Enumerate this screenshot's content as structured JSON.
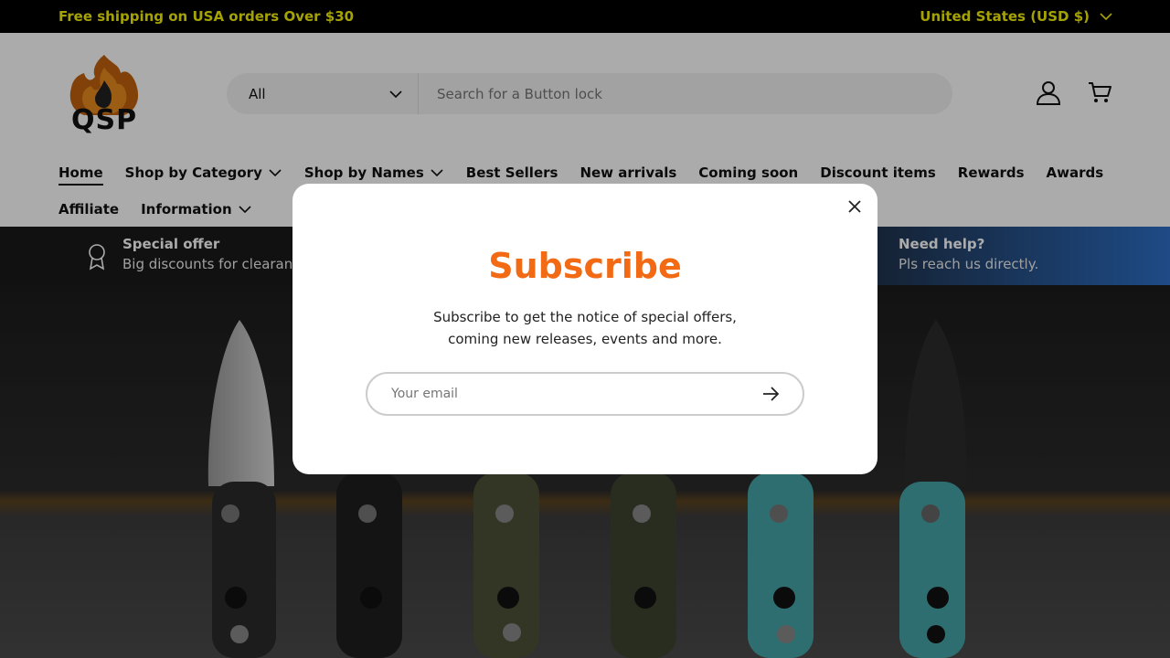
{
  "announcement": {
    "message": "Free shipping on USA orders Over $30",
    "country": "United States (USD $)"
  },
  "logo": {
    "text": "QSP"
  },
  "search": {
    "category": "All",
    "placeholder": "Search for a Button lock"
  },
  "header_icons": [
    "account-icon",
    "cart-icon"
  ],
  "nav": {
    "row1": [
      {
        "label": "Home",
        "active": true,
        "dropdown": false
      },
      {
        "label": "Shop by Category",
        "dropdown": true
      },
      {
        "label": "Shop by Names",
        "dropdown": true
      },
      {
        "label": "Best Sellers",
        "dropdown": false
      },
      {
        "label": "New arrivals",
        "dropdown": false
      },
      {
        "label": "Coming soon",
        "dropdown": false
      },
      {
        "label": "Discount items",
        "dropdown": false
      },
      {
        "label": "Rewards",
        "dropdown": false
      },
      {
        "label": "Awards",
        "dropdown": false
      }
    ],
    "row2": [
      {
        "label": "Affiliate",
        "dropdown": false
      },
      {
        "label": "Information",
        "dropdown": true
      }
    ]
  },
  "usp": {
    "left": {
      "title": "Special offer",
      "text": "Big discounts for clearan"
    },
    "right": {
      "title": "Need help?",
      "text": "Pls reach us directly."
    }
  },
  "modal": {
    "title": "Subscribe",
    "description": "Subscribe to get the notice of special offers, coming new releases, events and more.",
    "email_placeholder": "Your email"
  },
  "colors": {
    "announce_bg": "#000000",
    "announce_text": "#f5f207",
    "accent": "#f26a13",
    "help_gradient_end": "#2d6fc7"
  }
}
